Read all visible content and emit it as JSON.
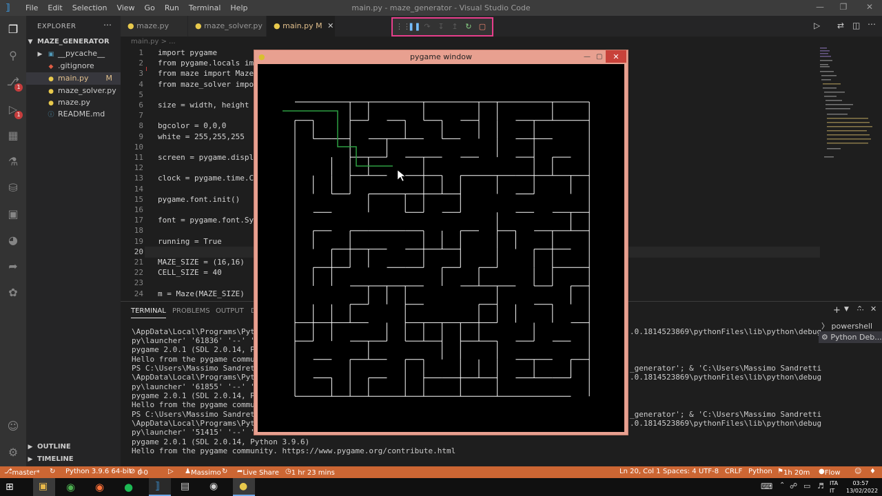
{
  "window": {
    "title": "main.py - maze_generator - Visual Studio Code",
    "menu": [
      "File",
      "Edit",
      "Selection",
      "View",
      "Go",
      "Run",
      "Terminal",
      "Help"
    ]
  },
  "sidebar": {
    "header": "EXPLORER",
    "root": "MAZE_GENERATOR",
    "items": [
      {
        "label": "__pycache__",
        "icon": "folder-icon",
        "color": "#519aba"
      },
      {
        "label": ".gitignore",
        "icon": "git-icon",
        "color": "#e05d44"
      },
      {
        "label": "main.py",
        "icon": "python-icon",
        "badge": "M",
        "color": "#e2c08d"
      },
      {
        "label": "maze_solver.py",
        "icon": "python-icon",
        "color": "#cccccc"
      },
      {
        "label": "maze.py",
        "icon": "python-icon",
        "color": "#cccccc"
      },
      {
        "label": "README.md",
        "icon": "info-icon",
        "color": "#cccccc"
      }
    ],
    "outline": "OUTLINE",
    "timeline": "TIMELINE"
  },
  "tabs": [
    {
      "label": "maze.py"
    },
    {
      "label": "maze_solver.py"
    },
    {
      "label": "main.py",
      "badge": "M"
    }
  ],
  "breadcrumb": "main.py > ...",
  "editor": {
    "line_numbers": [
      "1",
      "2",
      "3",
      "4",
      "5",
      "6",
      "7",
      "8",
      "9",
      "10",
      "11",
      "12",
      "13",
      "14",
      "15",
      "16",
      "17",
      "18",
      "19",
      "20",
      "21",
      "22",
      "23",
      "24"
    ],
    "lines": {
      "l1": "import pygame",
      "l2": "from pygame.locals import",
      "l3": "from maze import Maze",
      "l4": "from maze_solver import",
      "l6": "size = width, height =",
      "l8": "bgcolor = 0,0,0",
      "l9": "white = 255,255,255",
      "l11": "screen = pygame.display",
      "l13": "clock = pygame.time.Clo",
      "l15": "pygame.font.init()",
      "l17": "font = pygame.font.SysF",
      "l19": "running = True",
      "l21": "MAZE_SIZE = (16,16)",
      "l22": "CELL_SIZE = 40",
      "l24": "m = Maze(MAZE_SIZE)"
    }
  },
  "panel": {
    "tabs": [
      "TERMINAL",
      "PROBLEMS",
      "OUTPUT",
      "D"
    ],
    "terminal_left": [
      "\\AppData\\Local\\Programs\\Python",
      "py\\launcher' '61836' '--' 'c:\\",
      "pygame 2.0.1 (SDL 2.0.14, Pyth",
      "Hello from the pygame communit",
      "PS C:\\Users\\Massimo Sandretti\\",
      "\\AppData\\Local\\Programs\\Python",
      "py\\launcher' '61855' '--' 'c:\\",
      "pygame 2.0.1 (SDL 2.0.14, Pyth",
      "Hello from the pygame communit",
      "PS C:\\Users\\Massimo Sandretti\\",
      "\\AppData\\Local\\Programs\\Python",
      "py\\launcher' '51415' '--' 'c:\\",
      "pygame 2.0.1 (SDL 2.0.14, Python 3.9.6)",
      "Hello from the pygame community. https://www.pygame.org/contribute.html"
    ],
    "terminal_right": [
      {
        "row": 0,
        "text": ".0.1814523869\\pythonFiles\\lib\\python\\debug"
      },
      {
        "row": 4,
        "text": "_generator'; & 'C:\\Users\\Massimo Sandretti"
      },
      {
        "row": 5,
        "text": ".0.1814523869\\pythonFiles\\lib\\python\\debug"
      },
      {
        "row": 9,
        "text": "_generator'; & 'C:\\Users\\Massimo Sandretti"
      },
      {
        "row": 10,
        "text": ".0.1814523869\\pythonFiles\\lib\\python\\debug"
      }
    ],
    "terminals": [
      "powershell",
      "Python Deb..."
    ]
  },
  "pygame_window": {
    "title": "pygame window",
    "maze_size": 16,
    "wall_color": "#ffffff",
    "path_color": "#2ea043"
  },
  "statusbar": {
    "branch": "master*",
    "python": "Python 3.9.6 64-bit",
    "errors": "0",
    "warnings": "0",
    "user": "Massimo",
    "liveshare": "Live Share",
    "time_spent": "1 hr 23 mins",
    "position": "Ln 20, Col 1",
    "spaces": "Spaces: 4",
    "encoding": "UTF-8",
    "eol": "CRLF",
    "language": "Python",
    "duration": "1h 20m",
    "flow": "Flow"
  },
  "taskbar": {
    "lang": "ITA",
    "region": "IT",
    "time": "03:57",
    "date": "13/02/2022"
  }
}
